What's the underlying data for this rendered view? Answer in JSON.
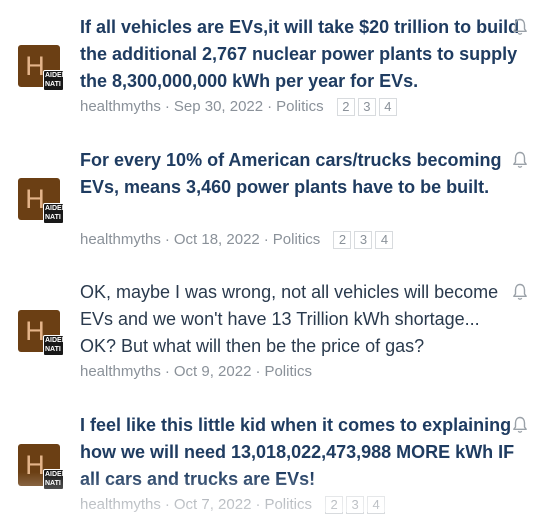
{
  "threads": [
    {
      "title": "If all vehicles are EVs,it will take $20 trillion to build the additional 2,767 nuclear power plants to supply the 8,300,000,000 kWh per year for EVs.",
      "author": "healthmyths",
      "date": "Sep 30, 2022",
      "forum": "Politics",
      "pages": [
        "2",
        "3",
        "4"
      ],
      "avatar_letter": "H",
      "avatar_badge": "AIDER NATI",
      "unread": true
    },
    {
      "title": "For every 10% of American cars/trucks becoming EVs, means 3,460 power plants have to be built.",
      "author": "healthmyths",
      "date": "Oct 18, 2022",
      "forum": "Politics",
      "pages": [
        "2",
        "3",
        "4"
      ],
      "avatar_letter": "H",
      "avatar_badge": "AIDER NATI",
      "unread": true
    },
    {
      "title": "OK, maybe I was wrong, not all vehicles will become EVs and we won't have 13 Trillion kWh shortage... OK? But what will then be the price of gas?",
      "author": "healthmyths",
      "date": "Oct 9, 2022",
      "forum": "Politics",
      "pages": [],
      "avatar_letter": "H",
      "avatar_badge": "AIDER NATI",
      "unread": false
    },
    {
      "title": "I feel like this little kid when it comes to explaining how we will need 13,018,022,473,988 MORE kWh IF all cars and trucks are EVs!",
      "author": "healthmyths",
      "date": "Oct 7, 2022",
      "forum": "Politics",
      "pages": [
        "2",
        "3",
        "4"
      ],
      "avatar_letter": "H",
      "avatar_badge": "AIDER NATI",
      "unread": true
    }
  ],
  "separator": "·",
  "icons": {
    "watch": "bell-icon",
    "avatar": "avatar-icon"
  },
  "colors": {
    "title_unread": "#1f3c61",
    "meta": "#8a9199",
    "avatar_bg": "#6b3f14"
  }
}
